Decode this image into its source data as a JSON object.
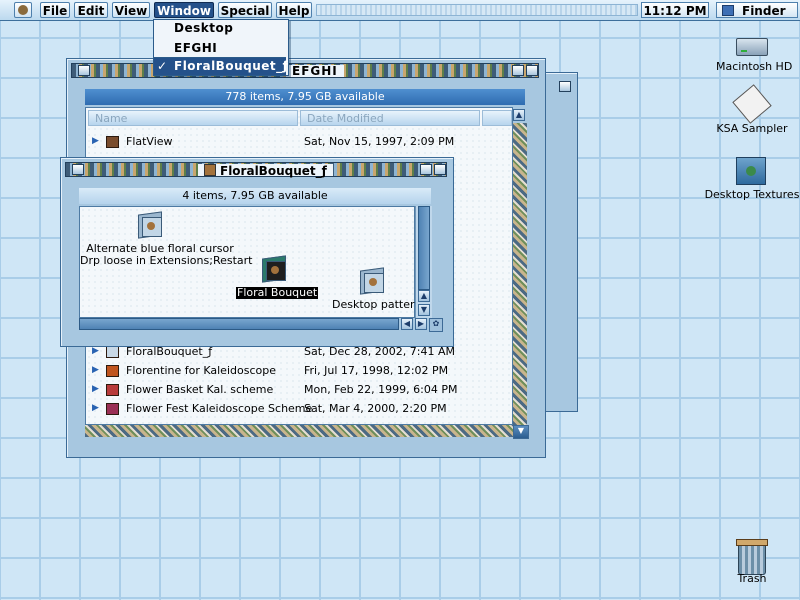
{
  "menubar": {
    "items": [
      "File",
      "Edit",
      "View",
      "Window",
      "Special",
      "Help"
    ],
    "active": "Window",
    "clock": "11:12 PM",
    "app": "Finder"
  },
  "window_menu": {
    "items": [
      {
        "label": "Desktop",
        "checked": false,
        "selected": false
      },
      {
        "label": "EFGHI",
        "checked": false,
        "selected": false
      },
      {
        "label": "FloralBouquet_ƒ",
        "checked": true,
        "selected": true
      }
    ],
    "check_mark": "✓"
  },
  "back_window": {
    "title": "EFGHI",
    "status": "778 items, 7.95 GB available",
    "columns": {
      "name": "Name",
      "date": "Date Modified"
    },
    "rows_top": [
      {
        "name": "FlatView",
        "date": "Sat, Nov 15, 1997, 2:09 PM"
      }
    ],
    "rows_bottom": [
      {
        "name": "FloralBouquet_ƒ",
        "date": "Sat, Dec 28, 2002, 7:41 AM"
      },
      {
        "name": "Florentine for Kaleidoscope",
        "date": "Fri, Jul 17, 1998, 12:02 PM"
      },
      {
        "name": "Flower Basket Kal. scheme",
        "date": "Mon, Feb 22, 1999, 6:04 PM"
      },
      {
        "name": "Flower Fest Kaleidoscope Scheme",
        "date": "Sat, Mar 4, 2000, 2:20 PM"
      }
    ]
  },
  "front_window": {
    "title": "FloralBouquet_ƒ",
    "status": "4 items, 7.95 GB available",
    "items": [
      {
        "label": "Alternate blue floral cursor\nDrp loose in Extensions;Restart",
        "selected": false
      },
      {
        "label": "Floral Bouquet",
        "selected": true
      },
      {
        "label": "Desktop patterns",
        "selected": false
      }
    ]
  },
  "desktop": {
    "icons": [
      {
        "label": "Macintosh HD",
        "icon": "hard-disk-icon"
      },
      {
        "label": "KSA Sampler",
        "icon": "pen-document-icon"
      },
      {
        "label": "Desktop Textures",
        "icon": "desktop-textures-icon"
      },
      {
        "label": "Trash",
        "icon": "trash-icon"
      }
    ]
  },
  "colors": {
    "desktop": "#cfe6f6",
    "grid": "#a9cde8",
    "selection": "#24518a",
    "status_bar": "#2f6cb0"
  }
}
